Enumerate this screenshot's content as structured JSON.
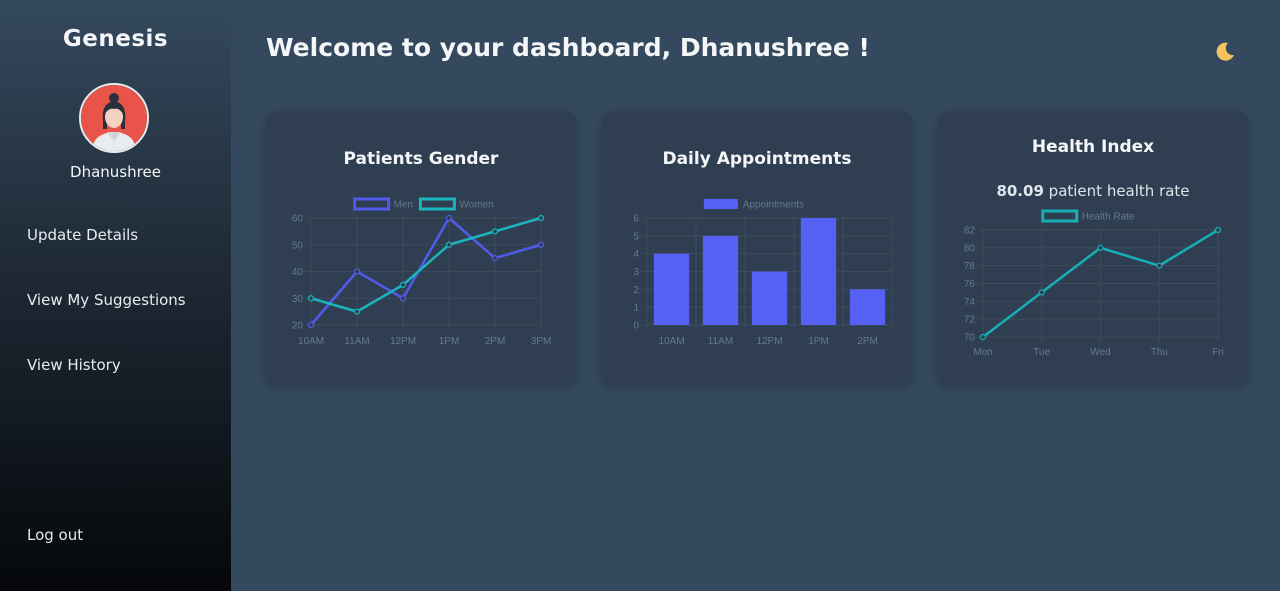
{
  "sidebar": {
    "brand": "Genesis",
    "username": "Dhanushree",
    "nav": [
      "Update Details",
      "View My Suggestions",
      "View History"
    ],
    "logout": "Log out"
  },
  "header": {
    "welcome": "Welcome to your dashboard, Dhanushree !",
    "theme_icon": "moon-icon"
  },
  "colors": {
    "men": "#4f5bea",
    "women": "#1bb5bd",
    "bar": "#5461f4",
    "health": "#17aeb7",
    "grid": "#3d4c5d"
  },
  "health": {
    "rate_value": "80.09",
    "rate_text": "patient health rate"
  },
  "chart_data": [
    {
      "type": "line",
      "title": "Patients Gender",
      "categories": [
        "10AM",
        "11AM",
        "12PM",
        "1PM",
        "2PM",
        "3PM"
      ],
      "series": [
        {
          "name": "Men",
          "values": [
            20,
            40,
            30,
            60,
            45,
            50
          ]
        },
        {
          "name": "Women",
          "values": [
            30,
            25,
            35,
            50,
            55,
            60
          ]
        }
      ],
      "yticks": [
        "20",
        "30",
        "40",
        "50",
        "60"
      ],
      "ylim": [
        20,
        60
      ],
      "legend": "top",
      "grid": true
    },
    {
      "type": "bar",
      "title": "Daily Appointments",
      "categories": [
        "10AM",
        "11AM",
        "12PM",
        "1PM",
        "2PM"
      ],
      "series": [
        {
          "name": "Appointments",
          "values": [
            4,
            5,
            3,
            6,
            2
          ]
        }
      ],
      "yticks": [
        "0",
        "1",
        "2",
        "3",
        "4",
        "5",
        "6"
      ],
      "ylim": [
        0,
        6
      ],
      "legend": "top",
      "grid": true
    },
    {
      "type": "line",
      "title": "Health Index",
      "categories": [
        "Mon",
        "Tue",
        "Wed",
        "Thu",
        "Fri"
      ],
      "series": [
        {
          "name": "Health Rate",
          "values": [
            70,
            75,
            80,
            78,
            82
          ]
        }
      ],
      "yticks": [
        "70",
        "72",
        "74",
        "76",
        "78",
        "80",
        "82"
      ],
      "ylim": [
        70,
        82
      ],
      "legend": "top",
      "grid": true
    }
  ]
}
